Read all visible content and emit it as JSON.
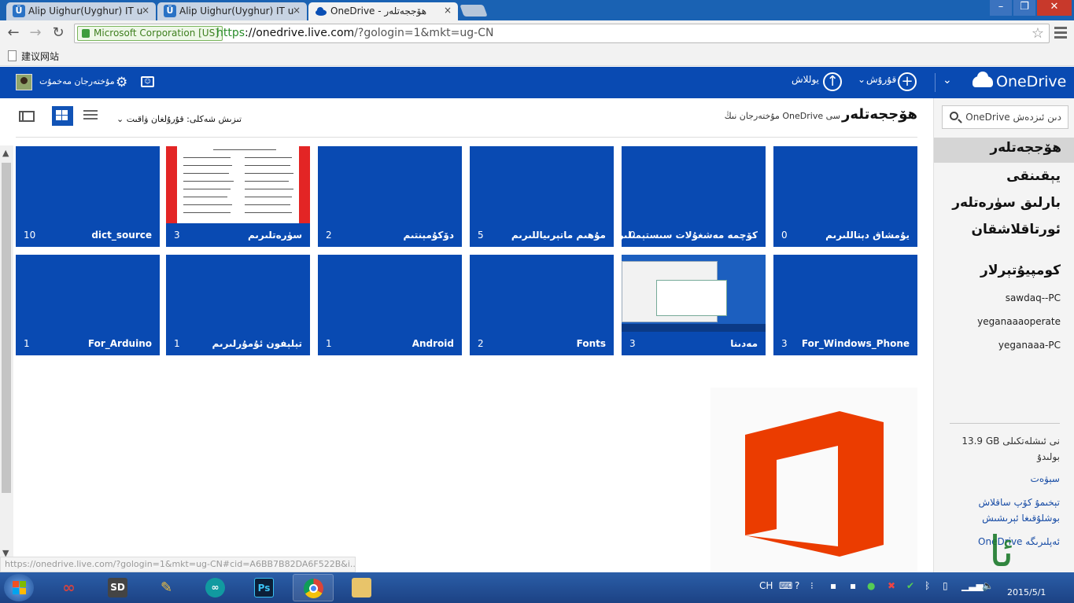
{
  "browser": {
    "tabs": [
      {
        "title": "Alip Uighur(Uyghur) IT u",
        "favicon": "Ü",
        "active": false
      },
      {
        "title": "Alip Uighur(Uyghur) IT u",
        "favicon": "Ü",
        "active": false
      },
      {
        "title": "OneDrive - ھۆججەتلەر",
        "favicon": "cloud",
        "active": true
      }
    ],
    "tab_close": "×",
    "window_controls": {
      "minimize": "–",
      "maximize": "❐",
      "close": "✕"
    },
    "cert_label": "Microsoft Corporation [US]",
    "url_protocol": "https",
    "url_host": "://onedrive.live.com",
    "url_path": "/?gologin=1&mkt=ug-CN",
    "bookmark": "建议网站"
  },
  "appbar": {
    "brand": "OneDrive",
    "new_label": "قۇرۇش",
    "upload_label": "يوللاش",
    "user_name": "مۇختەرجان مەخمۇت",
    "accent_color": "#094ab2"
  },
  "header": {
    "title": "ھۆججەتلەر",
    "breadcrumb": "مۇختەرجان نىڭ OneDrive سى",
    "sort_label": "تىزىش شەكلى: قۇرۇلغان ۋاقىت"
  },
  "tiles": [
    {
      "name": "يۇمشاق دېتاللىرىم",
      "count": "0"
    },
    {
      "name": "كۆچمە مەشغۇلات سىستېمىلىر",
      "count": "0"
    },
    {
      "name": "مۇھىم ماتېرىياللىرىم",
      "count": "5"
    },
    {
      "name": "دۆكۇمېنتىم",
      "count": "2"
    },
    {
      "name": "سۈرەتلىرىم",
      "count": "3"
    },
    {
      "name": "dict_source",
      "count": "10"
    },
    {
      "name": "For_Windows_Phone",
      "count": "3"
    },
    {
      "name": "مەدىنا",
      "count": "3"
    },
    {
      "name": "Fonts",
      "count": "2"
    },
    {
      "name": "Android",
      "count": "1"
    },
    {
      "name": "تېلېفون ئۇمۇرلىرىم",
      "count": "1"
    },
    {
      "name": "For_Arduino",
      "count": "1"
    }
  ],
  "sidebar": {
    "search_placeholder": "OneDrive دىن ئىزدەش",
    "nav": [
      "ھۆججەتلەر",
      "يېقىنقى",
      "بارلىق سۈرەتلەر",
      "ئورتاقلاشقان"
    ],
    "computers_heading": "كومپيۇتېرلار",
    "computers": [
      "sawdaq--PC",
      "yeganaaaoperate",
      "yeganaaa-PC"
    ],
    "storage_text": "13.9 GB نى ئىشلەتكىلى بولىدۇ",
    "link_recycle": "سېۋەت",
    "link_more_storage": "تېخىمۇ كۆپ ساقلاش بوشلۇقىغا ئېرىشىش",
    "link_apps": "OneDrive ئەپلىرىگە"
  },
  "status_url": "https://onedrive.live.com/?gologin=1&mkt=ug-CN#cid=A6BB7B82DA6F522B&i...",
  "taskbar": {
    "apps": [
      "infinity",
      "SD",
      "tools",
      "∞",
      "Ps",
      "chrome",
      "explorer"
    ],
    "tray_lang": "CH",
    "clock_date": "2015/5/1"
  },
  "watermark": "ئالقۇي"
}
